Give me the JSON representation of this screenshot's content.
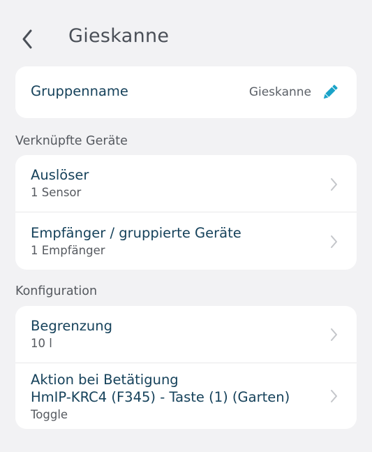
{
  "header": {
    "title": "Gieskanne",
    "back_icon": "chevron-left-icon"
  },
  "group_name": {
    "label": "Gruppenname",
    "value": "Gieskanne",
    "edit_icon": "pencil-icon",
    "accent_color": "#1aa3c8"
  },
  "sections": {
    "linked_devices": {
      "title": "Verknüpfte Geräte",
      "items": [
        {
          "title": "Auslöser",
          "subtitle": "1 Sensor"
        },
        {
          "title": "Empfänger / gruppierte Geräte",
          "subtitle": "1 Empfänger"
        }
      ]
    },
    "configuration": {
      "title": "Konfiguration",
      "items": [
        {
          "title": "Begrenzung",
          "subtitle": "10 l"
        },
        {
          "title": "Aktion bei Betätigung",
          "title2": "HmIP-KRC4 (F345) - Taste (1) (Garten)",
          "subtitle": "Toggle"
        }
      ]
    }
  },
  "colors": {
    "background": "#f2f2f4",
    "card": "#ffffff",
    "primary_text": "#16425b",
    "secondary_text": "#55595f",
    "chevron": "#c4c6ca"
  }
}
